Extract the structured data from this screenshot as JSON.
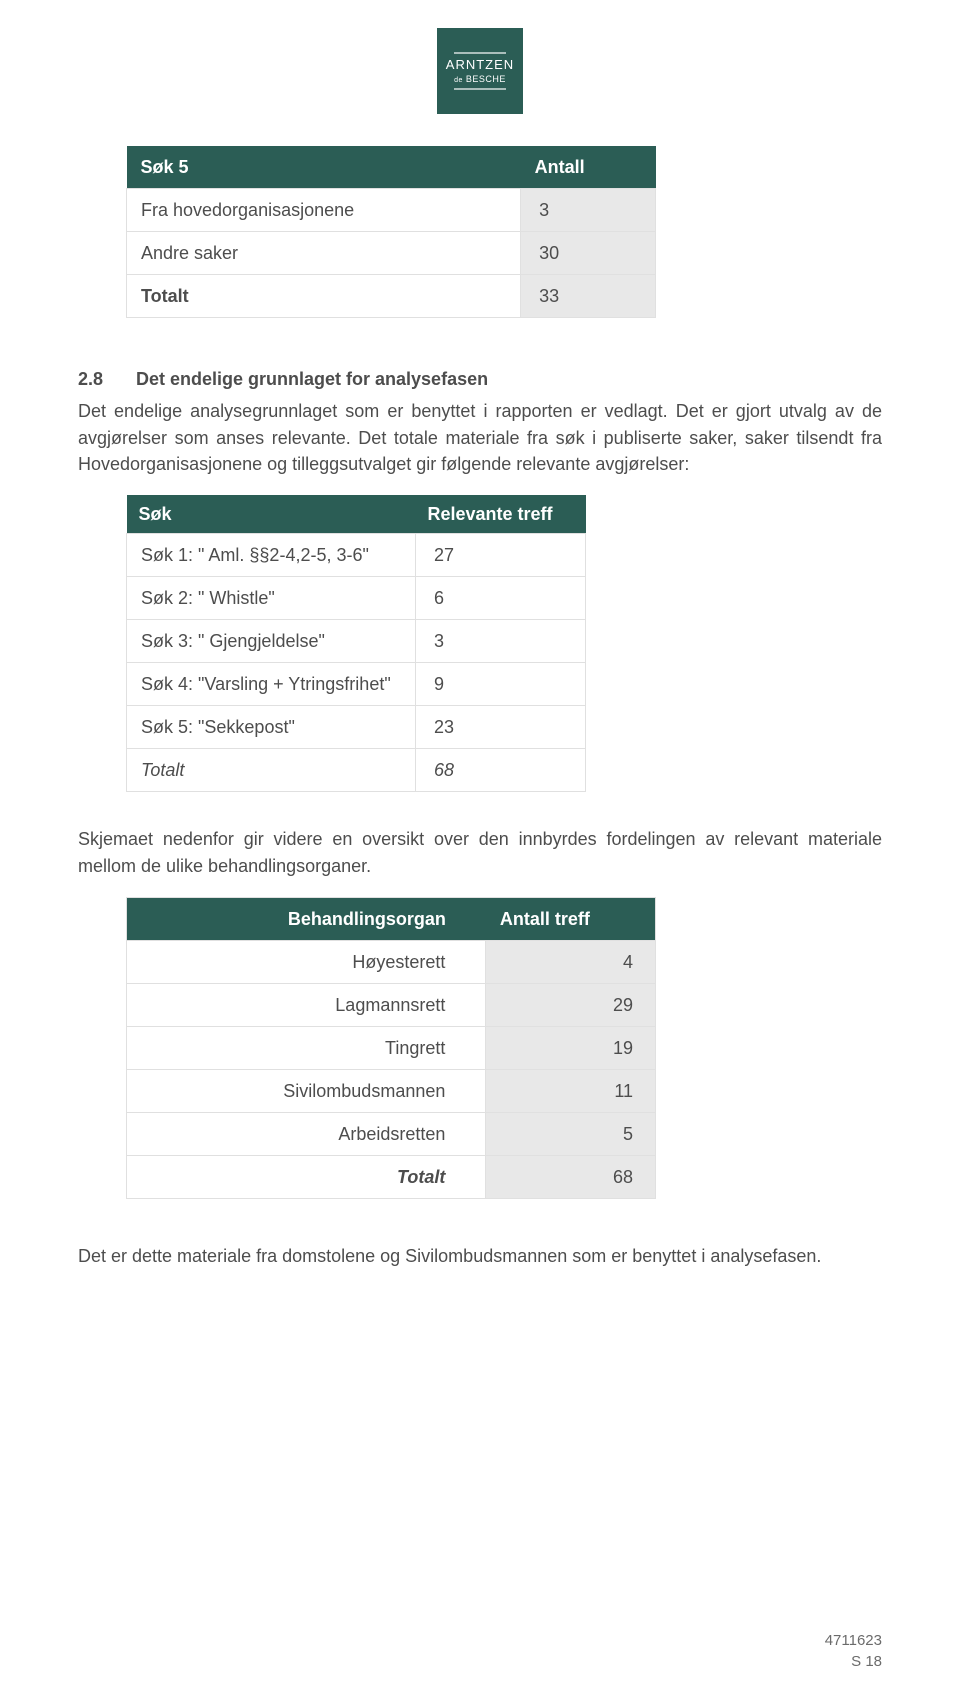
{
  "logo": {
    "line1": "ARNTZEN",
    "line2_small": "de",
    "line2": "BESCHE"
  },
  "table1": {
    "headers": [
      "Søk 5",
      "Antall"
    ],
    "rows": [
      {
        "label": "Fra hovedorganisasjonene",
        "value": "3"
      },
      {
        "label": "Andre saker",
        "value": "30"
      },
      {
        "label": "Totalt",
        "value": "33"
      }
    ]
  },
  "section": {
    "num": "2.8",
    "title": "Det endelige grunnlaget for analysefasen"
  },
  "para1": "Det endelige analysegrunnlaget som er benyttet i rapporten er vedlagt. Det er gjort utvalg av de avgjørelser som anses relevante. Det totale materiale fra søk i publiserte saker, saker tilsendt fra Hovedorganisasjonene og tilleggsutvalget gir følgende relevante avgjørelser:",
  "table2": {
    "headers": [
      "Søk",
      "Relevante treff"
    ],
    "rows": [
      {
        "label": "Søk 1: \" Aml. §§2-4,2-5, 3-6\"",
        "value": "27"
      },
      {
        "label": "Søk 2: \" Whistle\"",
        "value": "6"
      },
      {
        "label": "Søk 3: \" Gjengjeldelse\"",
        "value": "3"
      },
      {
        "label": "Søk 4: \"Varsling + Ytringsfrihet\"",
        "value": "9"
      },
      {
        "label": "Søk 5: \"Sekkepost\"",
        "value": "23"
      },
      {
        "label": "Totalt",
        "value": "68"
      }
    ]
  },
  "para2": "Skjemaet nedenfor gir videre en oversikt over den innbyrdes fordelingen av relevant materiale mellom de ulike behandlingsorganer.",
  "table3": {
    "headers": [
      "Behandlingsorgan",
      "Antall treff"
    ],
    "rows": [
      {
        "label": "Høyesterett",
        "value": "4"
      },
      {
        "label": "Lagmannsrett",
        "value": "29"
      },
      {
        "label": "Tingrett",
        "value": "19"
      },
      {
        "label": "Sivilombudsmannen",
        "value": "11"
      },
      {
        "label": "Arbeidsretten",
        "value": "5"
      },
      {
        "label": "Totalt",
        "value": "68"
      }
    ]
  },
  "para3": "Det er dette materiale fra domstolene og Sivilombudsmannen som er benyttet i analysefasen.",
  "footer": {
    "doc": "4711623",
    "page": "S 18"
  }
}
